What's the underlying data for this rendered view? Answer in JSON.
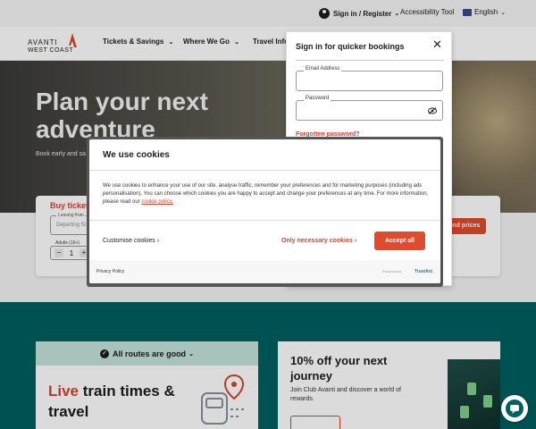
{
  "utility": {
    "signin_label": "Sign in / Register",
    "accessibility_label": "Accessibility Tool",
    "language_label": "English"
  },
  "logo": {
    "line1": "AVANTI",
    "line2": "WEST COAST"
  },
  "nav": {
    "items": [
      {
        "label": "Tickets & Savings"
      },
      {
        "label": "Where We Go"
      },
      {
        "label": "Travel Info"
      }
    ]
  },
  "hero": {
    "title": "Plan your next adventure",
    "subtitle": "Book early and sa"
  },
  "booking": {
    "title": "Buy tickets",
    "leaving_label": "Leaving from",
    "leaving_placeholder": "Departing St",
    "adults_label": "Adults (16+)",
    "adults_value": "1",
    "minus": "−",
    "plus": "+",
    "times_button": "s and prices"
  },
  "signin_panel": {
    "title": "Sign in for quicker bookings",
    "close": "✕",
    "email_label": "Email Address",
    "password_label": "Password",
    "forgot_link": "Forgotten password?"
  },
  "cookie": {
    "title": "We use cookies",
    "body": "We use cookies to enhance your use of our site, analyse traffic, remember your preferences and for marketing purposes (including ads personalisation). You can choose which cookies you are happy to accept and change your preferences at any time. For more information, please read our ",
    "policy_link": "cookie policy.",
    "customise": "Customise cookies",
    "only_necessary": "Only necessary cookies",
    "accept_all": "Accept all",
    "privacy_policy": "Privacy Policy",
    "powered_by": "Powered by:",
    "trustarc": "TrustArc"
  },
  "routes_card": {
    "banner": "All routes are good",
    "title_accent": "Live",
    "title_rest": " train times & travel"
  },
  "offer_card": {
    "title": "10% off your next journey",
    "text": "Join Club Avanti and discover a world of rewards."
  },
  "colors": {
    "brand_red": "#d8412f",
    "accept_orange": "#e14a2c",
    "teal": "#005f5f",
    "mint": "#c3e3da"
  }
}
